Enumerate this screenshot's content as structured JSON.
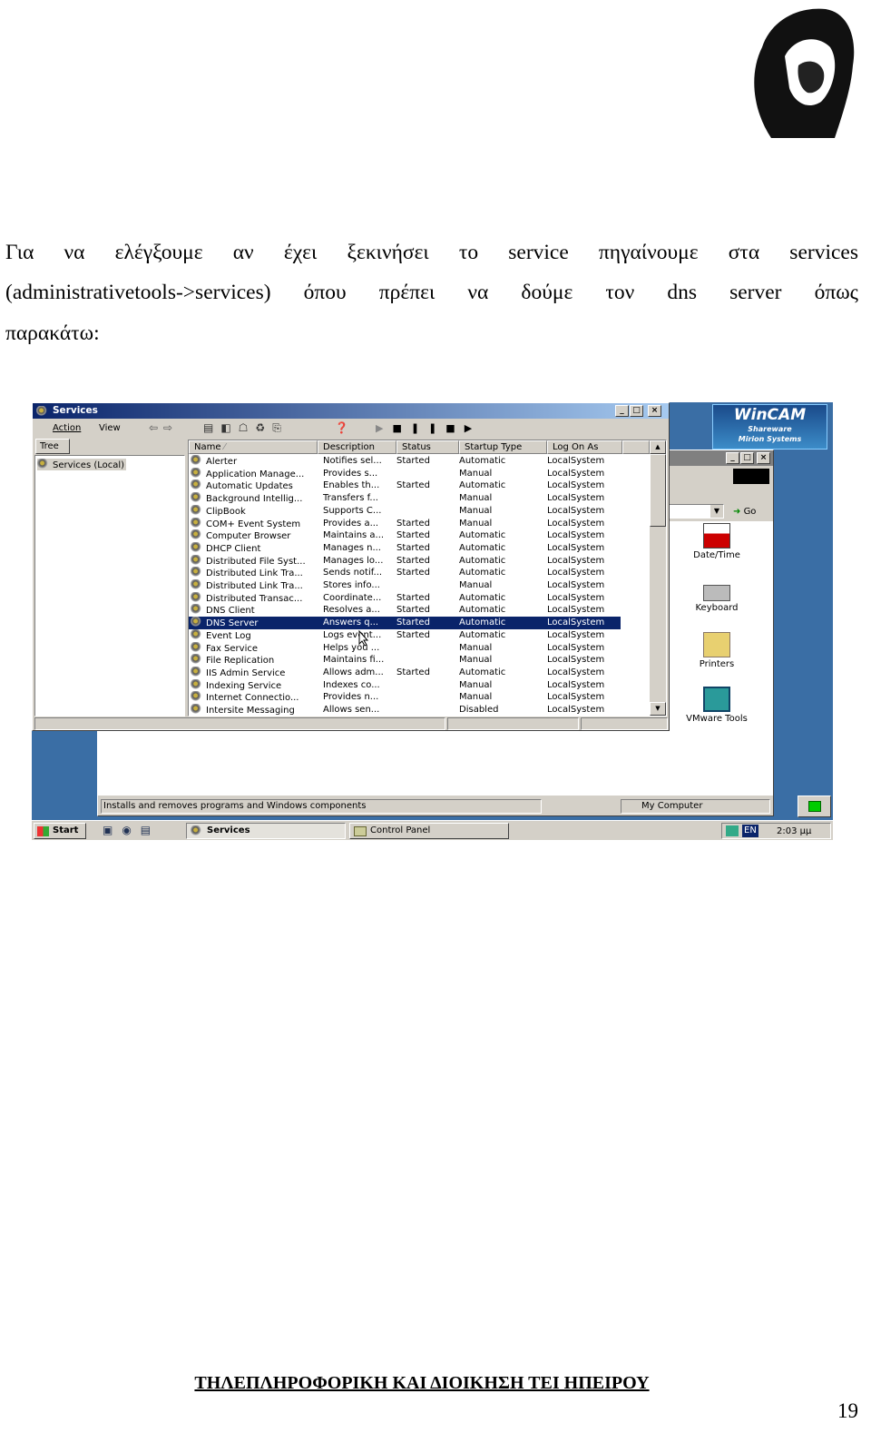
{
  "document": {
    "paragraph_lines": [
      "Για να ελέγξουμε αν έχει ξεκινήσει το service πηγαίνουμε στα services",
      "(administrativetools->services) όπου πρέπει να δούμε τον dns server όπως",
      "παρακάτω:"
    ],
    "footer": "ΤΗΛΕΠΛΗΡΟΦΟΡΙΚΗ ΚΑΙ ΔΙΟΙΚΗΣΗ ΤΕΙ ΗΠΕΙΡΟΥ",
    "page_number": "19"
  },
  "services_window": {
    "title": "Services",
    "menu": [
      "Action",
      "View"
    ],
    "tree_tab": "Tree",
    "tree_root": "Services (Local)",
    "columns": [
      "Name",
      "Description",
      "Status",
      "Startup Type",
      "Log On As"
    ],
    "selected_row": "DNS Server",
    "rows": [
      [
        "Alerter",
        "Notifies sel...",
        "Started",
        "Automatic",
        "LocalSystem"
      ],
      [
        "Application Manage...",
        "Provides s...",
        "",
        "Manual",
        "LocalSystem"
      ],
      [
        "Automatic Updates",
        "Enables th...",
        "Started",
        "Automatic",
        "LocalSystem"
      ],
      [
        "Background Intellig...",
        "Transfers f...",
        "",
        "Manual",
        "LocalSystem"
      ],
      [
        "ClipBook",
        "Supports C...",
        "",
        "Manual",
        "LocalSystem"
      ],
      [
        "COM+ Event System",
        "Provides a...",
        "Started",
        "Manual",
        "LocalSystem"
      ],
      [
        "Computer Browser",
        "Maintains a...",
        "Started",
        "Automatic",
        "LocalSystem"
      ],
      [
        "DHCP Client",
        "Manages n...",
        "Started",
        "Automatic",
        "LocalSystem"
      ],
      [
        "Distributed File Syst...",
        "Manages lo...",
        "Started",
        "Automatic",
        "LocalSystem"
      ],
      [
        "Distributed Link Tra...",
        "Sends notif...",
        "Started",
        "Automatic",
        "LocalSystem"
      ],
      [
        "Distributed Link Tra...",
        "Stores info...",
        "",
        "Manual",
        "LocalSystem"
      ],
      [
        "Distributed Transac...",
        "Coordinate...",
        "Started",
        "Automatic",
        "LocalSystem"
      ],
      [
        "DNS Client",
        "Resolves a...",
        "Started",
        "Automatic",
        "LocalSystem"
      ],
      [
        "DNS Server",
        "Answers q...",
        "Started",
        "Automatic",
        "LocalSystem"
      ],
      [
        "Event Log",
        "Logs event...",
        "Started",
        "Automatic",
        "LocalSystem"
      ],
      [
        "Fax Service",
        "Helps you ...",
        "",
        "Manual",
        "LocalSystem"
      ],
      [
        "File Replication",
        "Maintains fi...",
        "",
        "Manual",
        "LocalSystem"
      ],
      [
        "IIS Admin Service",
        "Allows adm...",
        "Started",
        "Automatic",
        "LocalSystem"
      ],
      [
        "Indexing Service",
        "Indexes co...",
        "",
        "Manual",
        "LocalSystem"
      ],
      [
        "Internet Connectio...",
        "Provides n...",
        "",
        "Manual",
        "LocalSystem"
      ],
      [
        "Intersite Messaging",
        "Allows sen...",
        "",
        "Disabled",
        "LocalSystem"
      ]
    ]
  },
  "control_panel": {
    "go_label": "Go",
    "icons": [
      "Date/Time",
      "Keyboard",
      "Printers",
      "VMware Tools"
    ],
    "status_text": "Installs and removes programs and Windows components",
    "status_location": "My Computer"
  },
  "wincam_logo": [
    "WinCAM",
    "Shareware",
    "Mirion Systems"
  ],
  "taskbar": {
    "start": "Start",
    "buttons": [
      "Services",
      "Control Panel"
    ],
    "language": "EN",
    "clock": "2:03 μμ"
  },
  "colors": {
    "selection": "#0a246a",
    "desktop": "#3a6ea5",
    "titlebar": "#0a246a"
  }
}
